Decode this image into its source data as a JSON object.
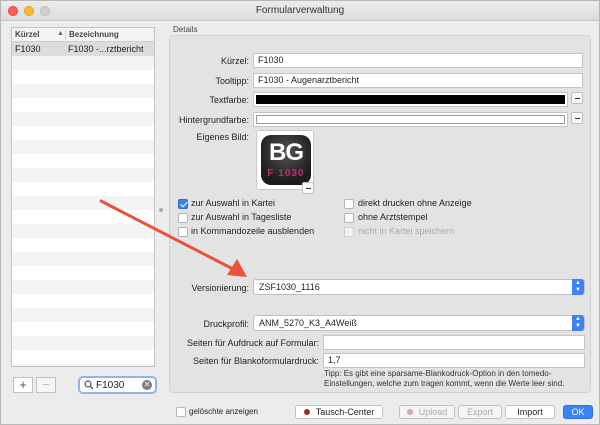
{
  "window": {
    "title": "Formularverwaltung"
  },
  "list": {
    "headers": {
      "kuerzel": "Kürzel",
      "sort_indicator": "▲",
      "bezeichnung": "Bezeichnung"
    },
    "rows": [
      {
        "kuerzel": "F1030",
        "bezeichnung": "F1030 -...rztbericht"
      }
    ]
  },
  "list_controls": {
    "add": "+",
    "remove": "−"
  },
  "search": {
    "value": "F1030"
  },
  "details": {
    "section_title": "Details",
    "kuerzel_label": "Kürzel:",
    "kuerzel_value": "F1030",
    "tooltip_label": "Tooltipp:",
    "tooltip_value": "F1030 - Augenarztbericht",
    "textfarbe_label": "Textfarbe:",
    "textfarbe_color": "#000000",
    "hintergrund_label": "Hintergrundfarbe:",
    "hintergrund_color": "#ffffff",
    "bild_label": "Eigenes Bild:",
    "logo_big": "BG",
    "logo_small": "F 1030",
    "checkboxes": {
      "auswahl_kartei": {
        "label": "zur Auswahl in Kartei",
        "checked": true
      },
      "auswahl_tagesliste": {
        "label": "zur Auswahl in Tagesliste",
        "checked": false
      },
      "kommandozeile": {
        "label": "in Kommandozeile ausblenden",
        "checked": false
      },
      "direkt_drucken": {
        "label": "direkt drucken ohne Anzeige",
        "checked": false
      },
      "ohne_arztstempel": {
        "label": "ohne Arztstempel",
        "checked": false
      },
      "nicht_speichern": {
        "label": "nicht in Kartei speichern",
        "checked": false
      }
    },
    "versionierung_label": "Versionierung:",
    "versionierung_value": "ZSF1030_1116",
    "druckprofil_label": "Druckprofil:",
    "druckprofil_value": "ANM_5270_K3_A4Weiß",
    "aufdruck_label": "Seiten für Aufdruck auf Formular:",
    "aufdruck_value": "",
    "blanko_label": "Seiten für Blankoformulardruck:",
    "blanko_value": "1,7",
    "hint": "Tipp: Es gibt eine sparsame-Blankodruck-Option in den tomedo-Einstellungen, welche zum tragen kommt, wenn die Werte leer sind."
  },
  "footer": {
    "geloeschte_label": "gelöschte anzeigen",
    "tausch_center": "Tausch-Center",
    "upload": "Upload",
    "export": "Export",
    "import": "Import",
    "ok": "OK"
  },
  "colors": {
    "accent": "#3b82f7",
    "annotation_arrow": "#e8533a"
  }
}
